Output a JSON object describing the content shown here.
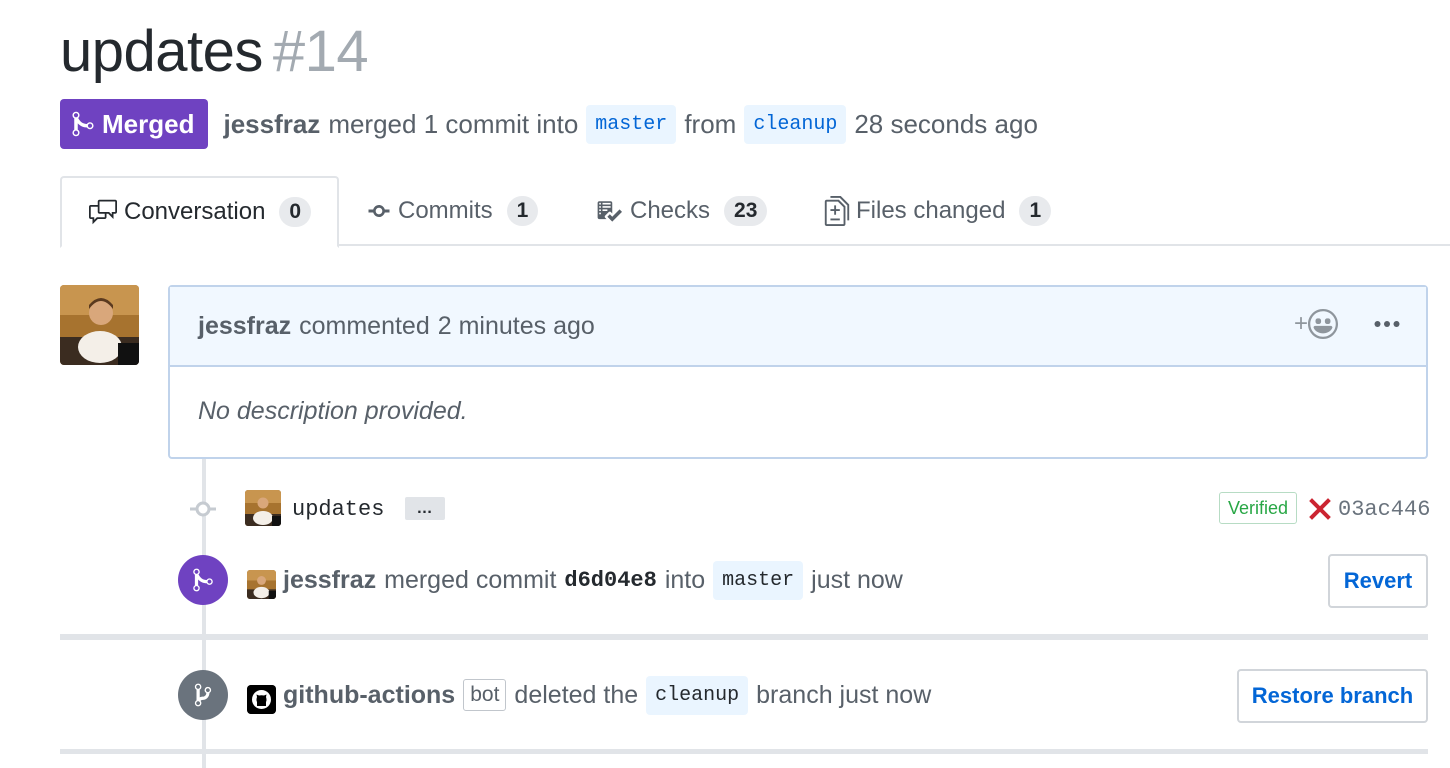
{
  "pr": {
    "title": "updates",
    "number": "#14",
    "state": "Merged",
    "author": "jessfraz",
    "merged_text": "merged 1 commit into",
    "base_branch": "master",
    "from_text": "from",
    "head_branch": "cleanup",
    "time": "28 seconds ago"
  },
  "tabs": [
    {
      "label": "Conversation",
      "count": "0",
      "icon": "comment-discussion-icon"
    },
    {
      "label": "Commits",
      "count": "1",
      "icon": "git-commit-icon"
    },
    {
      "label": "Checks",
      "count": "23",
      "icon": "checklist-icon"
    },
    {
      "label": "Files changed",
      "count": "1",
      "icon": "diff-icon"
    }
  ],
  "comment": {
    "author": "jessfraz",
    "action": "commented",
    "time": "2 minutes ago",
    "body": "No description provided.",
    "reaction_label": "+"
  },
  "commit": {
    "message": "updates",
    "ellipsis": "…",
    "verified": "Verified",
    "sha": "03ac446"
  },
  "merge_event": {
    "author": "jessfraz",
    "text1": "merged commit",
    "sha": "d6d04e8",
    "text2": "into",
    "branch": "master",
    "time": "just now",
    "button": "Revert"
  },
  "delete_event": {
    "author": "github-actions",
    "bot_label": "bot",
    "text1": "deleted the",
    "branch": "cleanup",
    "text2": "branch just now",
    "button": "Restore branch"
  },
  "colors": {
    "merged": "#6f42c1",
    "link": "#0366d6",
    "verified": "#28a745",
    "failure": "#cb2431",
    "deleted_badge": "#6a737d"
  }
}
